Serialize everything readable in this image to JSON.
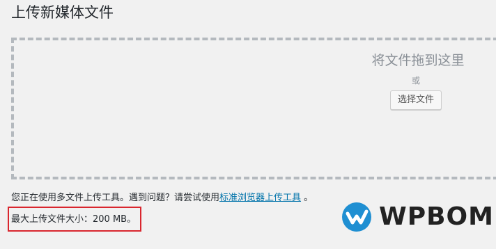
{
  "page": {
    "title": "上传新媒体文件"
  },
  "dropzone": {
    "instructions": "将文件拖到这里",
    "or_text": "或",
    "select_button_label": "选择文件"
  },
  "help": {
    "text_before_link": "您正在使用多文件上传工具。遇到问题？请尝试使用",
    "link_text": "标准浏览器上传工具",
    "text_after_link": "。"
  },
  "upload_limit": {
    "text": "最大上传文件大小：200 MB。"
  },
  "brand": {
    "name": "WPBOM",
    "logo_icon": "wpbom-logo-icon",
    "logo_color": "#1f8fd2",
    "highlight_color": "#d9262e"
  }
}
